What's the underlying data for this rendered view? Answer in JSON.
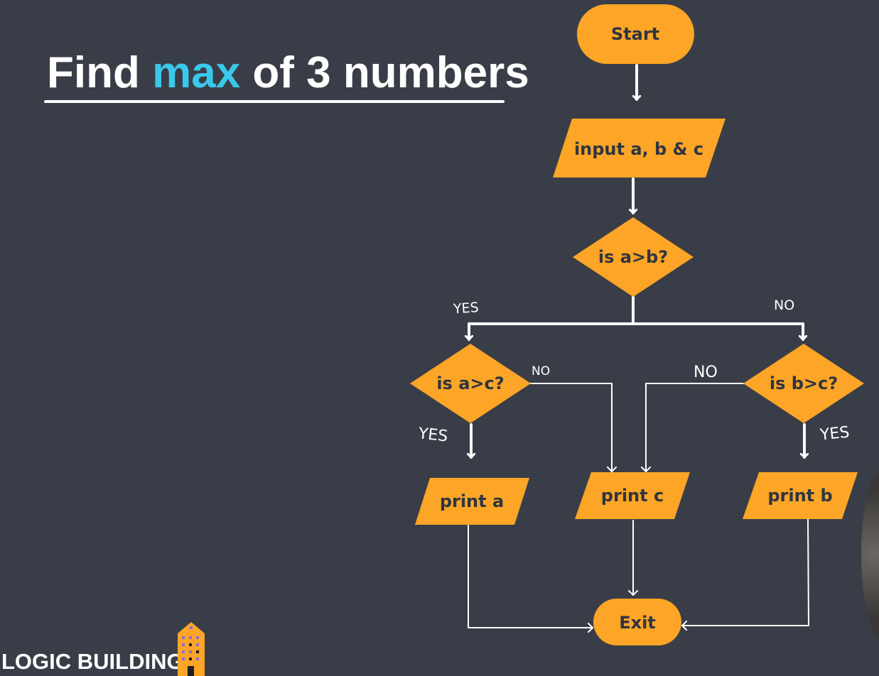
{
  "title": {
    "prefix": "Find ",
    "highlight": "max",
    "suffix": " of 3 numbers"
  },
  "nodes": {
    "start": "Start",
    "input": "input a, b & c",
    "cond_ab": "is a>b?",
    "cond_ac": "is a>c?",
    "cond_bc": "is b>c?",
    "print_a": "print a",
    "print_c": "print c",
    "print_b": "print b",
    "exit": "Exit"
  },
  "edge_labels": {
    "ab_yes": "YES",
    "ab_no": "NO",
    "ac_no": "NO",
    "ac_yes": "YES",
    "bc_no": "NO",
    "bc_yes": "YES"
  },
  "brand": "LOGIC BUILDING",
  "colors": {
    "background": "#393d47",
    "node_fill": "#fca526",
    "node_text": "#2f3540",
    "accent": "#3ac8ec",
    "line": "#ffffff"
  }
}
